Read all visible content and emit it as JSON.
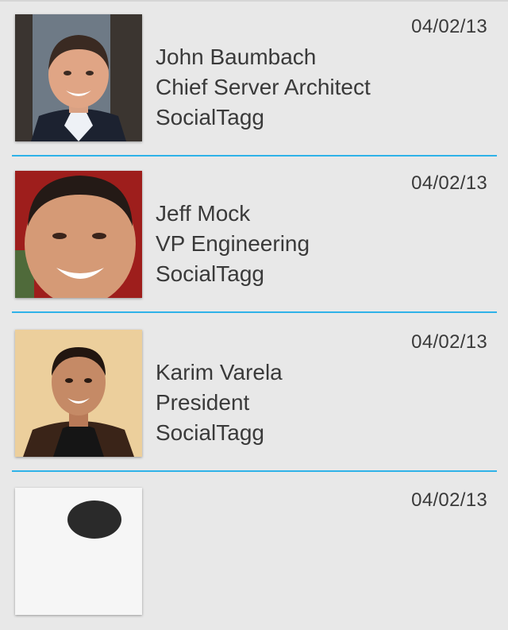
{
  "contacts": [
    {
      "name": "John Baumbach",
      "title": "Chief Server Architect",
      "company": "SocialTagg",
      "date": "04/02/13"
    },
    {
      "name": "Jeff Mock",
      "title": "VP Engineering",
      "company": "SocialTagg",
      "date": "04/02/13"
    },
    {
      "name": "Karim Varela",
      "title": "President",
      "company": "SocialTagg",
      "date": "04/02/13"
    },
    {
      "name": "",
      "title": "",
      "company": "",
      "date": "04/02/13"
    }
  ],
  "colors": {
    "divider": "#2fb2e8",
    "background": "#e8e8e8",
    "text": "#3a3a3a"
  },
  "icons": {
    "photo": "contact-photo"
  }
}
